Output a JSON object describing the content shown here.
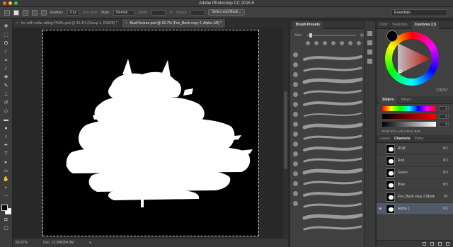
{
  "window": {
    "title": "Adobe Photoshop CC 2015.5"
  },
  "options_bar": {
    "feather_label": "Feather:",
    "feather_value": "0 px",
    "antialias_label": "Anti-alias",
    "style_label": "Style:",
    "style_value": "Normal",
    "width_label": "Width:",
    "height_label": "Height:",
    "select_mask_label": "Select and Mask...",
    "workspace_value": "Essentials"
  },
  "doc_tabs": [
    {
      "label": "fox with collar sitting FINAL.psd @ 33.3% (Group 1, RGB/8) *",
      "close": "×"
    },
    {
      "label": "BushTexture.psd @ 66.7% (Fox_Bush copy 2, Alpha 1/8) *",
      "close": "×"
    }
  ],
  "status": {
    "zoom": "66.67%",
    "doc_info": "Doc: 12.0M/264.3M"
  },
  "brush_panel": {
    "tab_active": "Brush Presets",
    "tab_other": "Brush",
    "size_label": "Size:"
  },
  "color_panel": {
    "tabs": [
      "Color",
      "Swatches",
      "Coolorus 2.5"
    ],
    "hex": "175757"
  },
  "sliders_panel": {
    "tabs": [
      "Sliders",
      "Mixers"
    ],
    "values": [
      "0",
      "0",
      "0"
    ],
    "modes": "RGB HSV LAB CMYK B/W"
  },
  "layers_panel": {
    "tabs": [
      "Layers",
      "Channels",
      "Paths"
    ],
    "channels": [
      {
        "name": "RGB",
        "shortcut": "⌘2",
        "eye": ""
      },
      {
        "name": "Red",
        "shortcut": "⌘3",
        "eye": ""
      },
      {
        "name": "Green",
        "shortcut": "⌘4",
        "eye": ""
      },
      {
        "name": "Blue",
        "shortcut": "⌘5",
        "eye": ""
      },
      {
        "name": "Fox_Bush copy 2 Mask",
        "shortcut": "⌘\\",
        "eye": ""
      },
      {
        "name": "Alpha 1",
        "shortcut": "⌘6",
        "eye": "◉"
      }
    ]
  },
  "colors": {
    "accent_selection": "#505a69",
    "canvas_bg": "#000000",
    "mask_fill": "#ffffff"
  }
}
